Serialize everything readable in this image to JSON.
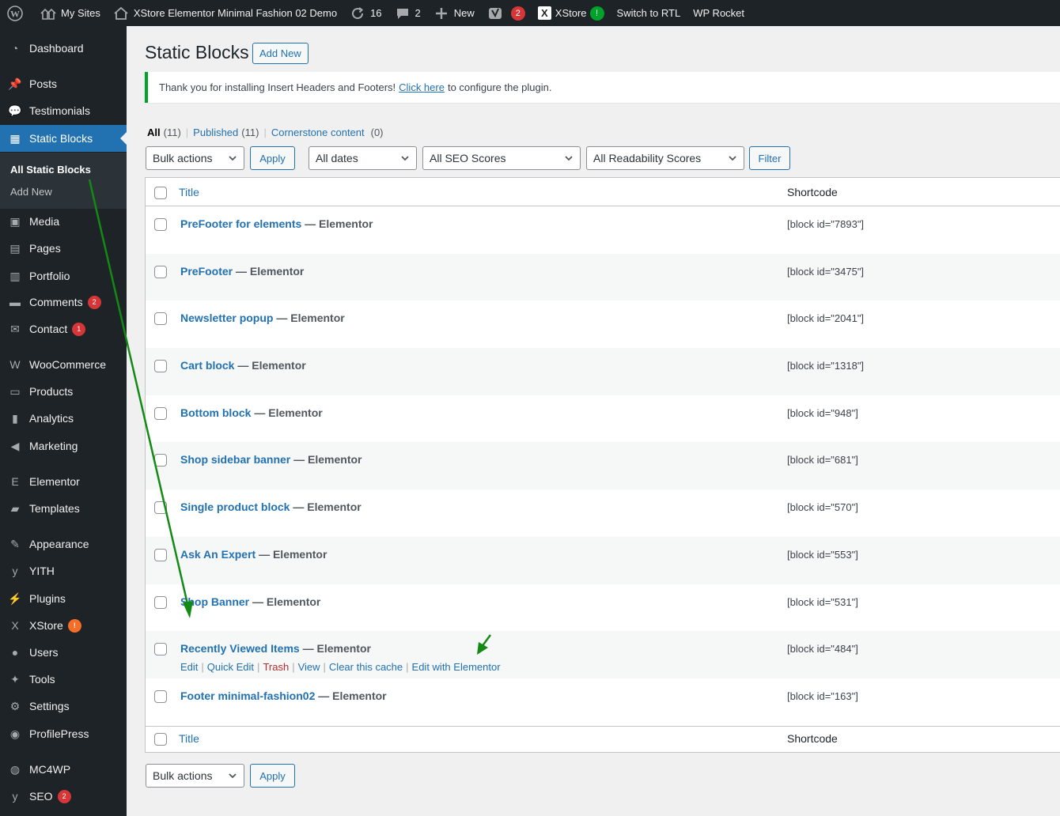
{
  "adminbar": {
    "my_sites": "My Sites",
    "site_name": "XStore Elementor Minimal Fashion 02 Demo",
    "updates_count": "16",
    "comments_count": "2",
    "new_label": "New",
    "yoast_badge": "2",
    "xstore_label": "XStore",
    "xstore_badge": "!",
    "rtl_label": "Switch to RTL",
    "rocket_label": "WP Rocket"
  },
  "sidebar": {
    "items": [
      {
        "label": "Dashboard",
        "icon": "dashboard-icon"
      },
      {
        "label": "Posts",
        "icon": "pin-icon"
      },
      {
        "label": "Testimonials",
        "icon": "speech-bubble-icon"
      },
      {
        "label": "Static Blocks",
        "icon": "table-icon"
      },
      {
        "label": "Media",
        "icon": "media-icon"
      },
      {
        "label": "Pages",
        "icon": "pages-icon"
      },
      {
        "label": "Portfolio",
        "icon": "portfolio-icon"
      },
      {
        "label": "Comments",
        "icon": "comment-icon",
        "badge": "2"
      },
      {
        "label": "Contact",
        "icon": "mail-icon",
        "badge": "1"
      },
      {
        "label": "WooCommerce",
        "icon": "woo-icon"
      },
      {
        "label": "Products",
        "icon": "products-icon"
      },
      {
        "label": "Analytics",
        "icon": "chart-bar-icon"
      },
      {
        "label": "Marketing",
        "icon": "megaphone-icon"
      },
      {
        "label": "Elementor",
        "icon": "elementor-icon"
      },
      {
        "label": "Templates",
        "icon": "folder-icon"
      },
      {
        "label": "Appearance",
        "icon": "brush-icon"
      },
      {
        "label": "YITH",
        "icon": "yith-icon"
      },
      {
        "label": "Plugins",
        "icon": "plug-icon"
      },
      {
        "label": "XStore",
        "icon": "xstore-icon",
        "badge": "!"
      },
      {
        "label": "Users",
        "icon": "user-icon"
      },
      {
        "label": "Tools",
        "icon": "wrench-icon"
      },
      {
        "label": "Settings",
        "icon": "settings-icon"
      },
      {
        "label": "ProfilePress",
        "icon": "profilepress-icon"
      },
      {
        "label": "MC4WP",
        "icon": "mc4wp-icon"
      },
      {
        "label": "SEO",
        "icon": "yoast-icon",
        "badge": "2"
      }
    ],
    "submenu": [
      "All Static Blocks",
      "Add New"
    ]
  },
  "page": {
    "title": "Static Blocks",
    "add_new": "Add New"
  },
  "notice": {
    "text_before": "Thank you for installing Insert Headers and Footers!",
    "link": "Click here",
    "text_after": "to configure the plugin."
  },
  "views": {
    "all": "All",
    "all_count": "(11)",
    "published": "Published",
    "published_count": "(11)",
    "cornerstone": "Cornerstone content",
    "cornerstone_count": "(0)"
  },
  "filters": {
    "bulk_actions": "Bulk actions",
    "apply": "Apply",
    "dates": "All dates",
    "seo": "All SEO Scores",
    "readability": "All Readability Scores",
    "filter": "Filter"
  },
  "table": {
    "col_title": "Title",
    "col_shortcode": "Shortcode",
    "state": "— Elementor",
    "rows": [
      {
        "title": "PreFooter for elements",
        "shortcode": "[block id=\"7893\"]"
      },
      {
        "title": "PreFooter",
        "shortcode": "[block id=\"3475\"]"
      },
      {
        "title": "Newsletter popup",
        "shortcode": "[block id=\"2041\"]"
      },
      {
        "title": "Cart block",
        "shortcode": "[block id=\"1318\"]"
      },
      {
        "title": "Bottom block",
        "shortcode": "[block id=\"948\"]"
      },
      {
        "title": "Shop sidebar banner",
        "shortcode": "[block id=\"681\"]"
      },
      {
        "title": "Single product block",
        "shortcode": "[block id=\"570\"]"
      },
      {
        "title": "Ask An Expert",
        "shortcode": "[block id=\"553\"]"
      },
      {
        "title": "Shop Banner",
        "shortcode": "[block id=\"531\"]"
      },
      {
        "title": "Recently Viewed Items",
        "shortcode": "[block id=\"484\"]"
      },
      {
        "title": "Footer minimal-fashion02",
        "shortcode": "[block id=\"163\"]"
      }
    ],
    "row_actions": [
      "Edit",
      "Quick Edit",
      "Trash",
      "View",
      "Clear this cache",
      "Edit with Elementor"
    ]
  },
  "annotation_color": "#138a13"
}
